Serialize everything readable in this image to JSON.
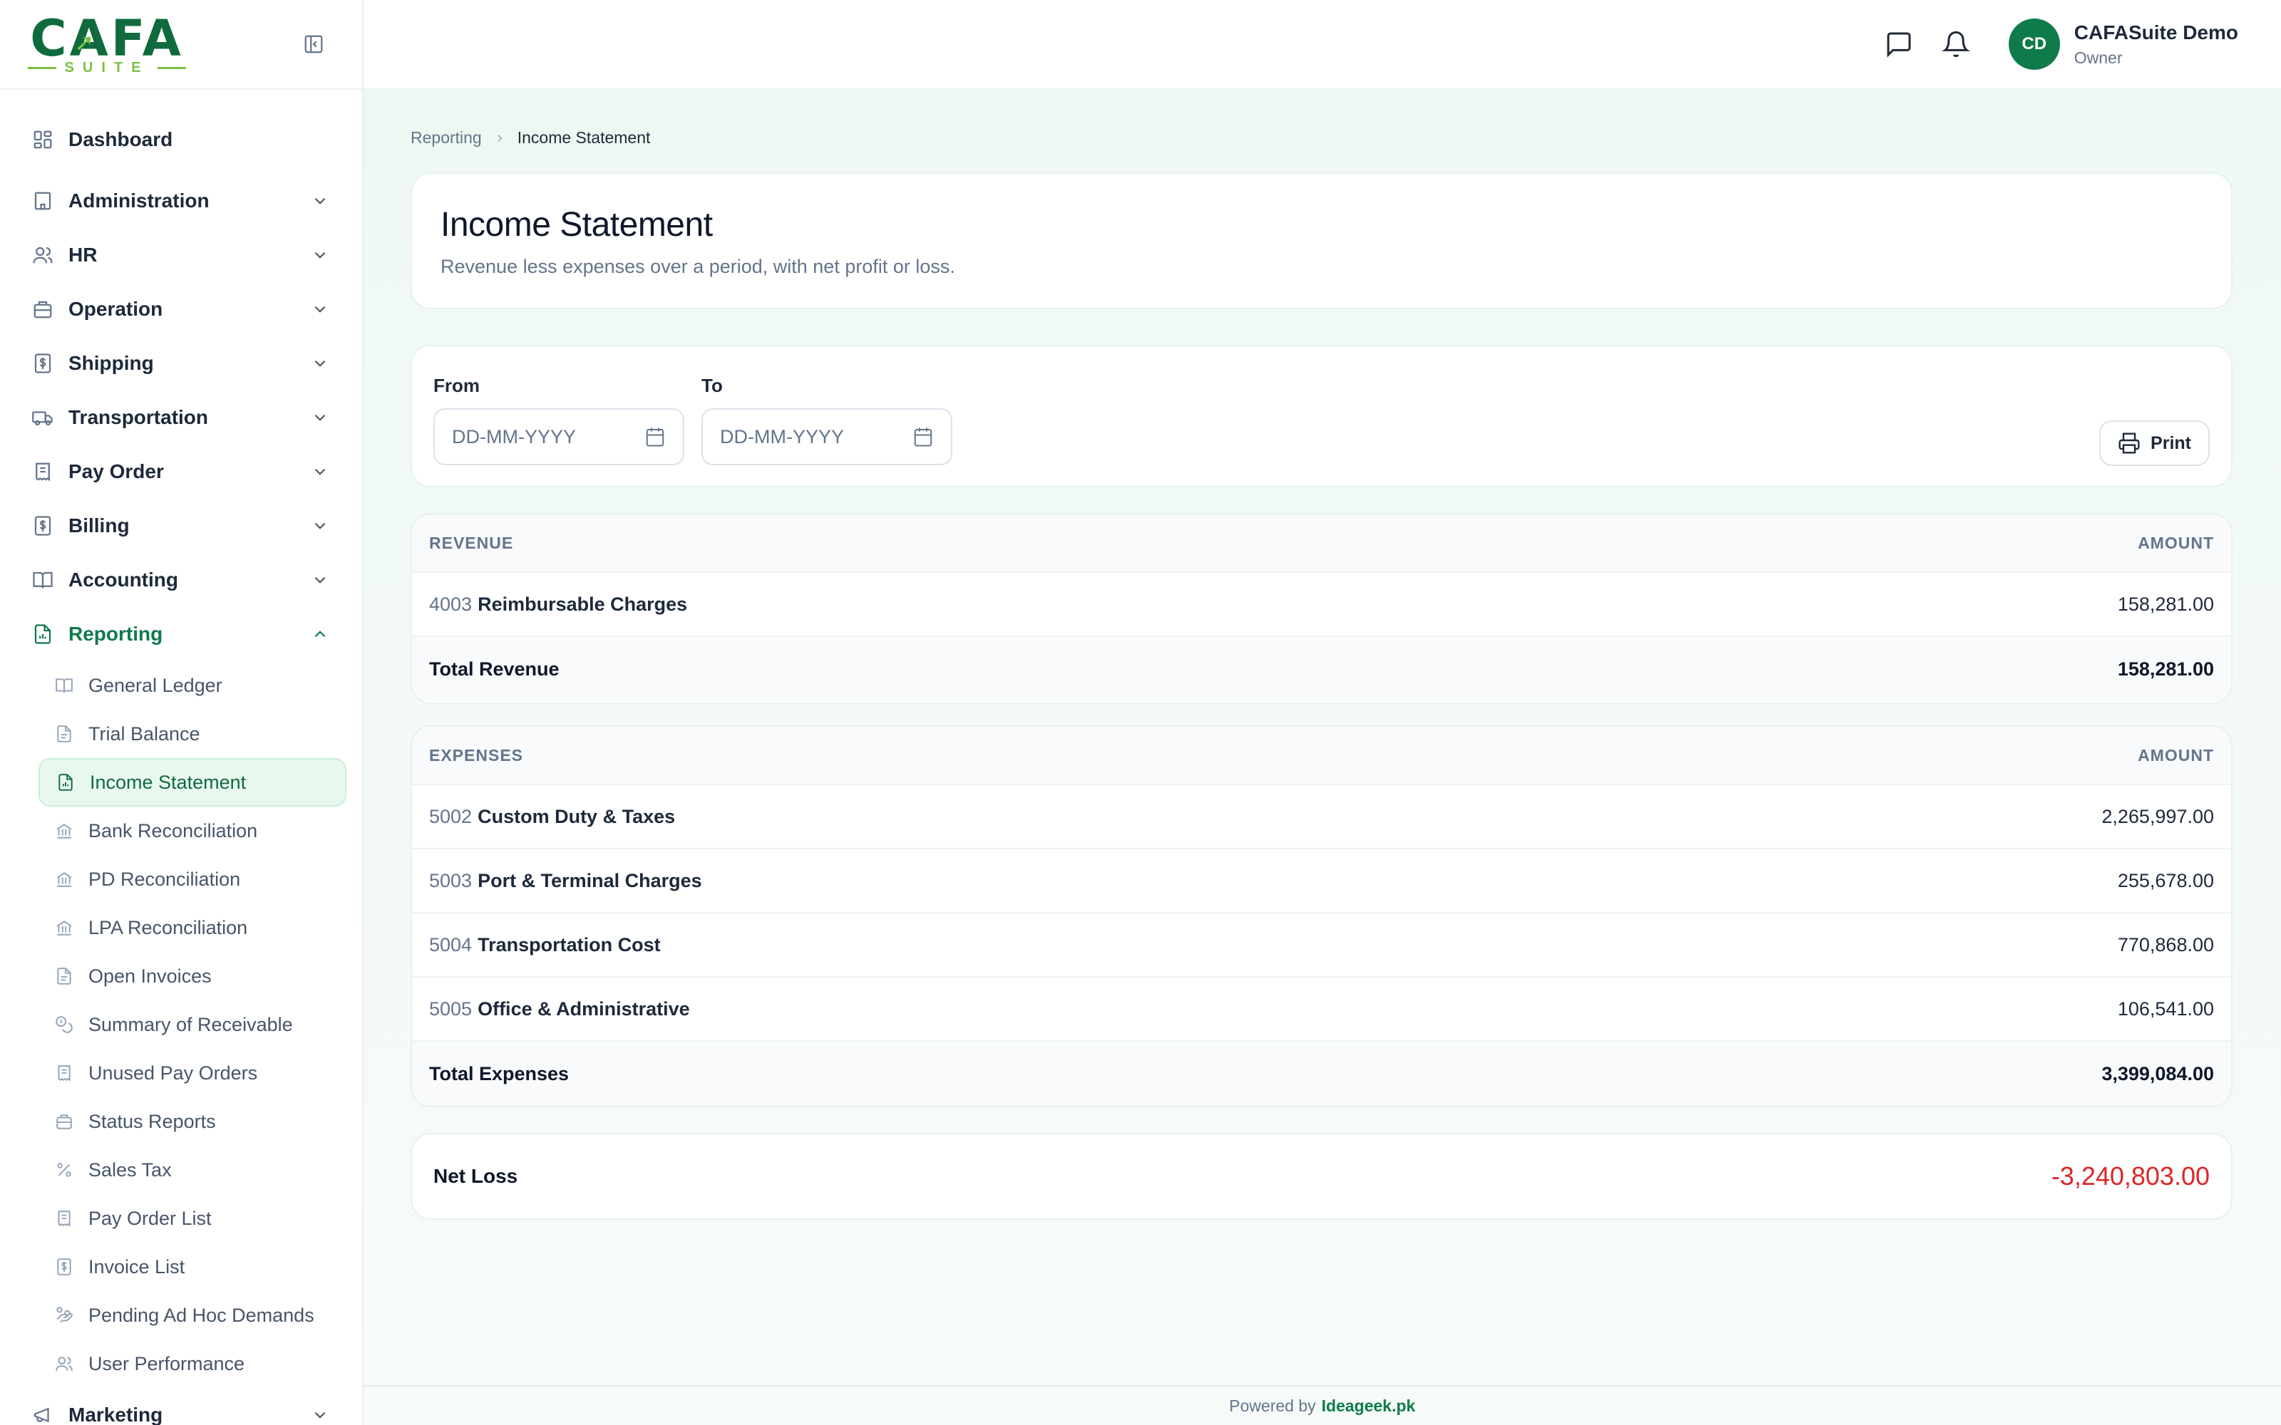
{
  "brand": {
    "logo_text": "CAFA",
    "logo_sub": "SUITE"
  },
  "sidebar": {
    "items": [
      {
        "label": "Dashboard",
        "icon": "dashboard-grid-icon"
      },
      {
        "label": "Administration",
        "icon": "building-icon"
      },
      {
        "label": "HR",
        "icon": "users-icon"
      },
      {
        "label": "Operation",
        "icon": "briefcase-icon"
      },
      {
        "label": "Shipping",
        "icon": "dollar-doc-icon"
      },
      {
        "label": "Transportation",
        "icon": "truck-icon"
      },
      {
        "label": "Pay Order",
        "icon": "receipt-icon"
      },
      {
        "label": "Billing",
        "icon": "dollar-doc-icon"
      },
      {
        "label": "Accounting",
        "icon": "book-icon"
      },
      {
        "label": "Reporting",
        "icon": "report-icon"
      },
      {
        "label": "Marketing",
        "icon": "megaphone-icon"
      }
    ],
    "reporting_children": [
      {
        "label": "General Ledger",
        "icon": "book-icon"
      },
      {
        "label": "Trial Balance",
        "icon": "doc-icon"
      },
      {
        "label": "Income Statement",
        "icon": "report-icon"
      },
      {
        "label": "Bank Reconciliation",
        "icon": "bank-icon"
      },
      {
        "label": "PD Reconciliation",
        "icon": "bank-icon"
      },
      {
        "label": "LPA Reconciliation",
        "icon": "bank-icon"
      },
      {
        "label": "Open Invoices",
        "icon": "doc-icon"
      },
      {
        "label": "Summary of Receivable",
        "icon": "coins-icon"
      },
      {
        "label": "Unused Pay Orders",
        "icon": "receipt-icon"
      },
      {
        "label": "Status Reports",
        "icon": "briefcase-icon"
      },
      {
        "label": "Sales Tax",
        "icon": "percent-icon"
      },
      {
        "label": "Pay Order List",
        "icon": "receipt-icon"
      },
      {
        "label": "Invoice List",
        "icon": "dollar-doc-icon"
      },
      {
        "label": "Pending Ad Hoc Demands",
        "icon": "hand-coins-icon"
      },
      {
        "label": "User Performance",
        "icon": "users-icon"
      }
    ]
  },
  "topbar": {
    "user_initials": "CD",
    "user_name": "CAFASuite Demo",
    "user_role": "Owner"
  },
  "breadcrumb": {
    "parent": "Reporting",
    "current": "Income Statement"
  },
  "page": {
    "title": "Income Statement",
    "subtitle": "Revenue less expenses over a period, with net profit or loss."
  },
  "filters": {
    "from_label": "From",
    "to_label": "To",
    "from_placeholder": "DD-MM-YYYY",
    "to_placeholder": "DD-MM-YYYY",
    "print_label": "Print"
  },
  "revenue": {
    "header": "REVENUE",
    "amount_header": "AMOUNT",
    "rows": [
      {
        "code": "4003",
        "name": "Reimbursable Charges",
        "amount": "158,281.00"
      }
    ],
    "total_label": "Total Revenue",
    "total_amount": "158,281.00"
  },
  "expenses": {
    "header": "EXPENSES",
    "amount_header": "AMOUNT",
    "rows": [
      {
        "code": "5002",
        "name": "Custom Duty & Taxes",
        "amount": "2,265,997.00"
      },
      {
        "code": "5003",
        "name": "Port & Terminal Charges",
        "amount": "255,678.00"
      },
      {
        "code": "5004",
        "name": "Transportation Cost",
        "amount": "770,868.00"
      },
      {
        "code": "5005",
        "name": "Office & Administrative",
        "amount": "106,541.00"
      }
    ],
    "total_label": "Total Expenses",
    "total_amount": "3,399,084.00"
  },
  "net": {
    "label": "Net Loss",
    "value": "-3,240,803.00"
  },
  "footer": {
    "prefix": "Powered by",
    "brand": "Ideageek.pk"
  },
  "colors": {
    "accent": "#0f7a4a",
    "loss": "#dc2626",
    "active_bg": "#e9f8ef"
  }
}
